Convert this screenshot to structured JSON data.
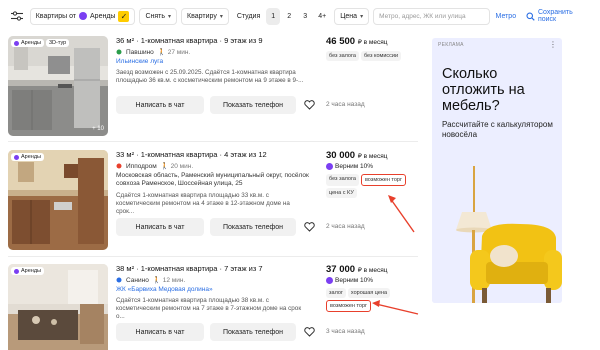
{
  "filters": {
    "deal_type": "Квартиры от",
    "brand": "Аренды",
    "action": "Снять",
    "property": "Квартиру",
    "rooms": [
      "Студия",
      "1",
      "2",
      "3",
      "4+"
    ],
    "active_room": "1",
    "price": "Цена",
    "address_placeholder": "Метро, адрес, ЖК или улица",
    "metro": "Метро",
    "save_search": "Сохранить поиск"
  },
  "listings": [
    {
      "title": "36 м² · 1-комнатная квартира · 9 этаж из 9",
      "metro": "Павшино",
      "walk": "27 мин.",
      "address_link": "Ильинские луга",
      "address_text": "",
      "description": "Заезд возможен с 25.09.2025. Сдаётся 1-комнатная квартира площадью 36 кв.м. с косметическим ремонтом на 9 этаже в 9-...",
      "badges": [
        "Аренды",
        "3D-тур"
      ],
      "photo_count": "+ 10",
      "price": "46 500",
      "price_unit": "₽ в месяц",
      "cashback": "",
      "tags": [
        {
          "text": "без залога",
          "highlight": false
        },
        {
          "text": "без комиссии",
          "highlight": false
        }
      ],
      "posted": "2 часа назад"
    },
    {
      "title": "33 м² · 1-комнатная квартира · 4 этаж из 12",
      "metro": "Ипподром",
      "walk": "20 мин.",
      "address_link": "",
      "address_text": "Московская область, Раменский муниципальный округ, посёлок совхоза Раменское, Шоссейная улица, 25",
      "description": "Сдаётся 1-комнатная квартира площадью 33 кв.м. с косметическим ремонтом на 4 этаже в 12-этажном доме на срок...",
      "badges": [
        "Аренды"
      ],
      "photo_count": "",
      "price": "30 000",
      "price_unit": "₽ в месяц",
      "cashback": "Верним 10%",
      "tags": [
        {
          "text": "без залога",
          "highlight": false
        },
        {
          "text": "возможен торг",
          "highlight": true
        },
        {
          "text": "цена с КУ",
          "highlight": false
        }
      ],
      "posted": "2 часа назад"
    },
    {
      "title": "38 м² · 1-комнатная квартира · 7 этаж из 7",
      "metro": "Санино",
      "walk": "12 мин.",
      "address_link": "ЖК «Барвиха Медовая долина»",
      "address_text": "",
      "description": "Сдаётся 1-комнатная квартира площадью 38 кв.м. с косметическим ремонтом на 7 этаже в 7-этажном доме на срок о...",
      "badges": [
        "Аренды"
      ],
      "photo_count": "",
      "price": "37 000",
      "price_unit": "₽ в месяц",
      "cashback": "Верним 10%",
      "tags": [
        {
          "text": "залог",
          "highlight": false
        },
        {
          "text": "хорошая цена",
          "highlight": false
        },
        {
          "text": "возможен торг",
          "highlight": true
        }
      ],
      "posted": "3 часа назад"
    }
  ],
  "actions": {
    "chat": "Написать в чат",
    "phone": "Показать телефон"
  },
  "ad": {
    "label": "РЕКЛАМА",
    "headline": "Сколько отложить на мебель?",
    "subline": "Рассчитайте с калькулятором новосёла"
  },
  "colors": {
    "accent_link": "#2a6ee4",
    "brand_purple": "#7b3ff2",
    "yellow": "#ffcc00",
    "highlight_red": "#e8402c"
  }
}
